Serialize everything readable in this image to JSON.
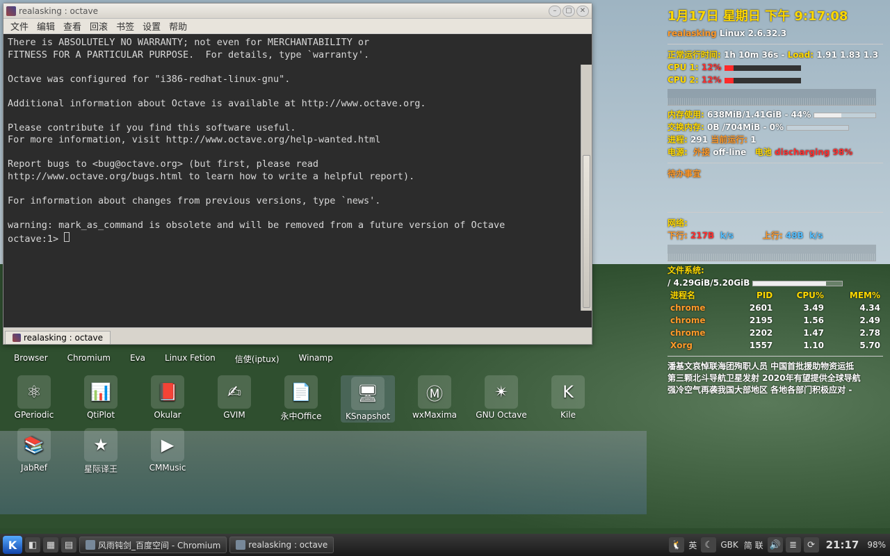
{
  "window": {
    "title": "realasking : octave",
    "menu": [
      "文件",
      "编辑",
      "查看",
      "回滚",
      "书签",
      "设置",
      "帮助"
    ],
    "tab": "realasking : octave",
    "terminal_lines": [
      "There is ABSOLUTELY NO WARRANTY; not even for MERCHANTABILITY or",
      "FITNESS FOR A PARTICULAR PURPOSE.  For details, type `warranty'.",
      "",
      "Octave was configured for \"i386-redhat-linux-gnu\".",
      "",
      "Additional information about Octave is available at http://www.octave.org.",
      "",
      "Please contribute if you find this software useful.",
      "For more information, visit http://www.octave.org/help-wanted.html",
      "",
      "Report bugs to <bug@octave.org> (but first, please read",
      "http://www.octave.org/bugs.html to learn how to write a helpful report).",
      "",
      "For information about changes from previous versions, type `news'.",
      "",
      "warning: mark_as_command is obsolete and will be removed from a future version of Octave",
      "octave:1> "
    ]
  },
  "conky": {
    "date": "1月17日 星期日  下午 9:17:08",
    "hostname": "realasking",
    "kernel": "Linux 2.6.32.3",
    "uptime_label": "正常运行时间:",
    "uptime": "1h 10m 36s",
    "load_label": "Load:",
    "load": "1.91 1.83 1.3",
    "cpu": [
      {
        "label": "CPU 1:",
        "pct": "12%",
        "w": 12
      },
      {
        "label": "CPU 2:",
        "pct": "12%",
        "w": 12
      }
    ],
    "mem_label": "内存使用:",
    "mem": "638MiB/1.41GiB - 44%",
    "mem_w": 44,
    "swap_label": "交换内存:",
    "swap": "0B  /704MiB - 0%",
    "swap_w": 0,
    "proc_label": "进程:",
    "procs": "291",
    "running_label": "当前运行:",
    "running": "1",
    "power_label": "电源:",
    "power_src_label": "外接",
    "power_src": "off-line",
    "batt_label": "电池",
    "batt": "discharging 98%",
    "todo_label": "待办事宜",
    "net_label": "网络:",
    "down_label": "下行:",
    "down": "217B",
    "down_unit": "k/s",
    "up_label": "上行:",
    "up": "48B",
    "up_unit": "k/s",
    "fs_label": "文件系统:",
    "fs": "/ 4.29GiB/5.20GiB",
    "fs_w": 82,
    "proc_headers": [
      "进程名",
      "PID",
      "CPU%",
      "MEM%"
    ],
    "proc_rows": [
      {
        "name": "chrome",
        "pid": "2601",
        "cpu": "3.49",
        "mem": "4.34"
      },
      {
        "name": "chrome",
        "pid": "2195",
        "cpu": "1.56",
        "mem": "2.49"
      },
      {
        "name": "chrome",
        "pid": "2202",
        "cpu": "1.47",
        "mem": "2.78"
      },
      {
        "name": "Xorg",
        "pid": "1557",
        "cpu": "1.10",
        "mem": "5.70"
      }
    ],
    "news": [
      "潘基文哀悼联海团殉职人员 中国首批援助物资运抵",
      "第三颗北斗导航卫星发射 2020年有望提供全球导航",
      "强冷空气再袭我国大部地区 各地各部门积极应对 -"
    ]
  },
  "desktop_labels_row1": [
    "Browser",
    "Chromium",
    "Eva",
    "Linux Fetion",
    "信使(iptux)",
    "Winamp"
  ],
  "desktop_icons": [
    {
      "label": "GPeriodic",
      "glyph": "⚛"
    },
    {
      "label": "QtiPlot",
      "glyph": "📊"
    },
    {
      "label": "Okular",
      "glyph": "📕"
    },
    {
      "label": "GVIM",
      "glyph": "✍"
    },
    {
      "label": "永中Office",
      "glyph": "📄"
    },
    {
      "label": "KSnapshot",
      "glyph": "🖥"
    },
    {
      "label": "wxMaxima",
      "glyph": "Ⓜ"
    },
    {
      "label": "GNU Octave",
      "glyph": "✴"
    },
    {
      "label": "Kile",
      "glyph": "K"
    },
    {
      "label": "JabRef",
      "glyph": "📚"
    },
    {
      "label": "星际译王",
      "glyph": "★"
    },
    {
      "label": "CMMusic",
      "glyph": "▶"
    }
  ],
  "taskbar": {
    "tasks": [
      "风雨钝剑_百度空间 - Chromium",
      "realasking : octave"
    ],
    "ime": "英",
    "enc": "GBK",
    "mode": "简 联",
    "batt": "98%",
    "clock": "21:17"
  }
}
